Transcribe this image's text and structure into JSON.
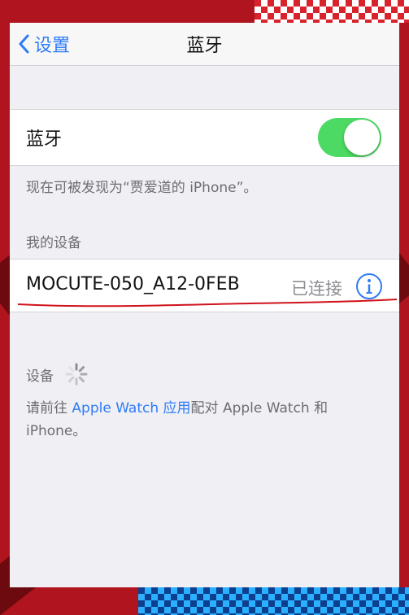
{
  "nav": {
    "back_label": "设置",
    "title": "蓝牙"
  },
  "bluetooth": {
    "label": "蓝牙",
    "enabled": true,
    "toggle_color": "#4cd964",
    "discoverable_text": "现在可被发现为“贾爱道的 iPhone”。"
  },
  "my_devices": {
    "header": "我的设备",
    "items": [
      {
        "name": "MOCUTE-050_A12-0FEB",
        "status": "已连接",
        "icon": "info-icon"
      }
    ]
  },
  "devices": {
    "header": "设备",
    "loading_icon": "spinner-icon"
  },
  "hint": {
    "prefix": "请前往 ",
    "link": "Apple Watch 应用",
    "suffix": "配对 Apple Watch 和 iPhone。"
  },
  "colors": {
    "accent": "#2f7cf6",
    "annotation_underline": "#d0121c"
  }
}
